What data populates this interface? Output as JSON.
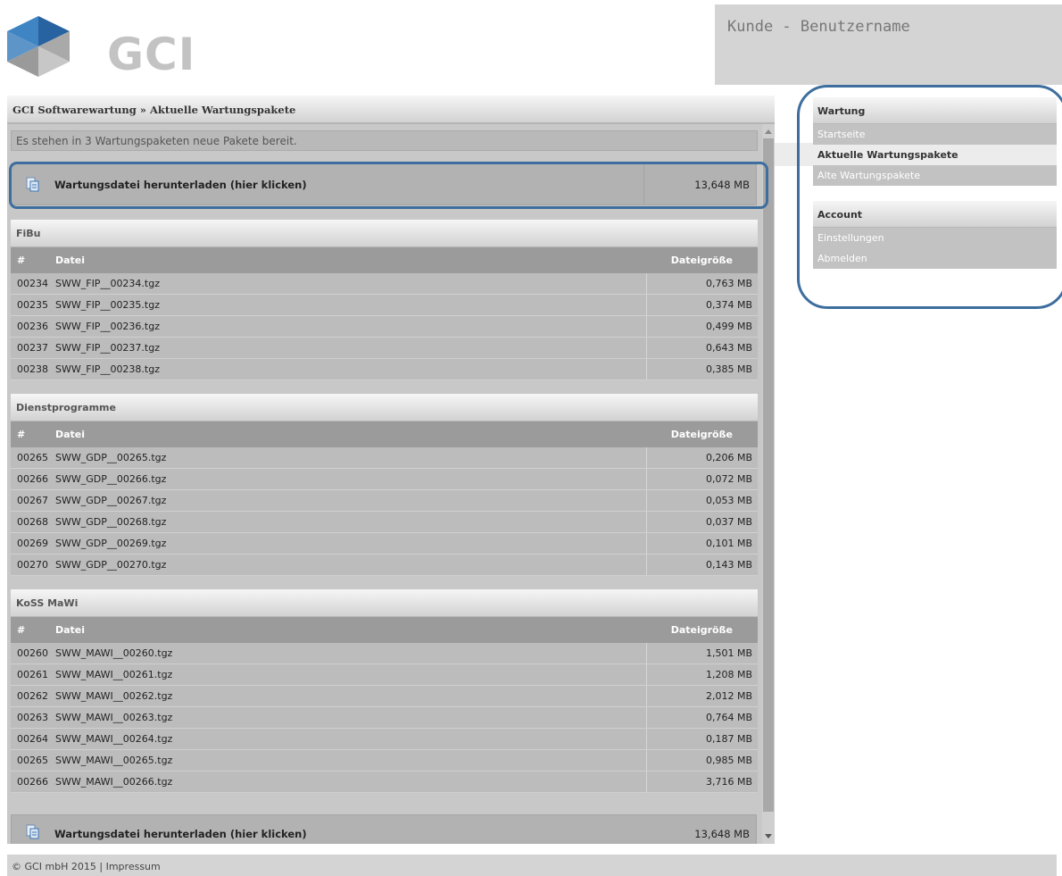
{
  "brand": {
    "name": "GCI"
  },
  "user": {
    "label": "Kunde - Benutzername"
  },
  "breadcrumb": "GCI Softwarewartung » Aktuelle Wartungspakete",
  "info": "Es stehen in 3 Wartungspaketen neue Pakete bereit.",
  "download": {
    "label": "Wartungsdatei herunterladen (hier klicken)",
    "size": "13,648 MB"
  },
  "columns": {
    "num": "#",
    "file": "Datei",
    "size": "Dateigröße"
  },
  "groups": [
    {
      "title": "FiBu",
      "rows": [
        {
          "num": "00234",
          "file": "SWW_FIP__00234.tgz",
          "size": "0,763 MB"
        },
        {
          "num": "00235",
          "file": "SWW_FIP__00235.tgz",
          "size": "0,374 MB"
        },
        {
          "num": "00236",
          "file": "SWW_FIP__00236.tgz",
          "size": "0,499 MB"
        },
        {
          "num": "00237",
          "file": "SWW_FIP__00237.tgz",
          "size": "0,643 MB"
        },
        {
          "num": "00238",
          "file": "SWW_FIP__00238.tgz",
          "size": "0,385 MB"
        }
      ]
    },
    {
      "title": "Dienstprogramme",
      "rows": [
        {
          "num": "00265",
          "file": "SWW_GDP__00265.tgz",
          "size": "0,206 MB"
        },
        {
          "num": "00266",
          "file": "SWW_GDP__00266.tgz",
          "size": "0,072 MB"
        },
        {
          "num": "00267",
          "file": "SWW_GDP__00267.tgz",
          "size": "0,053 MB"
        },
        {
          "num": "00268",
          "file": "SWW_GDP__00268.tgz",
          "size": "0,037 MB"
        },
        {
          "num": "00269",
          "file": "SWW_GDP__00269.tgz",
          "size": "0,101 MB"
        },
        {
          "num": "00270",
          "file": "SWW_GDP__00270.tgz",
          "size": "0,143 MB"
        }
      ]
    },
    {
      "title": "KoSS MaWi",
      "rows": [
        {
          "num": "00260",
          "file": "SWW_MAWI__00260.tgz",
          "size": "1,501 MB"
        },
        {
          "num": "00261",
          "file": "SWW_MAWI__00261.tgz",
          "size": "1,208 MB"
        },
        {
          "num": "00262",
          "file": "SWW_MAWI__00262.tgz",
          "size": "2,012 MB"
        },
        {
          "num": "00263",
          "file": "SWW_MAWI__00263.tgz",
          "size": "0,764 MB"
        },
        {
          "num": "00264",
          "file": "SWW_MAWI__00264.tgz",
          "size": "0,187 MB"
        },
        {
          "num": "00265",
          "file": "SWW_MAWI__00265.tgz",
          "size": "0,985 MB"
        },
        {
          "num": "00266",
          "file": "SWW_MAWI__00266.tgz",
          "size": "3,716 MB"
        }
      ]
    }
  ],
  "sidebar": {
    "wartung": {
      "title": "Wartung",
      "items": [
        "Startseite",
        "Aktuelle Wartungspakete",
        "Alte Wartungspakete"
      ]
    },
    "account": {
      "title": "Account",
      "items": [
        "Einstellungen",
        "Abmelden"
      ]
    }
  },
  "footer": "© GCI mbH 2015 | Impressum",
  "colors": {
    "highlight": "#3d6e9e",
    "logo_dark": "#2b6aa8",
    "logo_light": "#4e8fcb",
    "logo_grey": "#c3c3c3"
  },
  "icons": {
    "download": "download-file-icon"
  }
}
